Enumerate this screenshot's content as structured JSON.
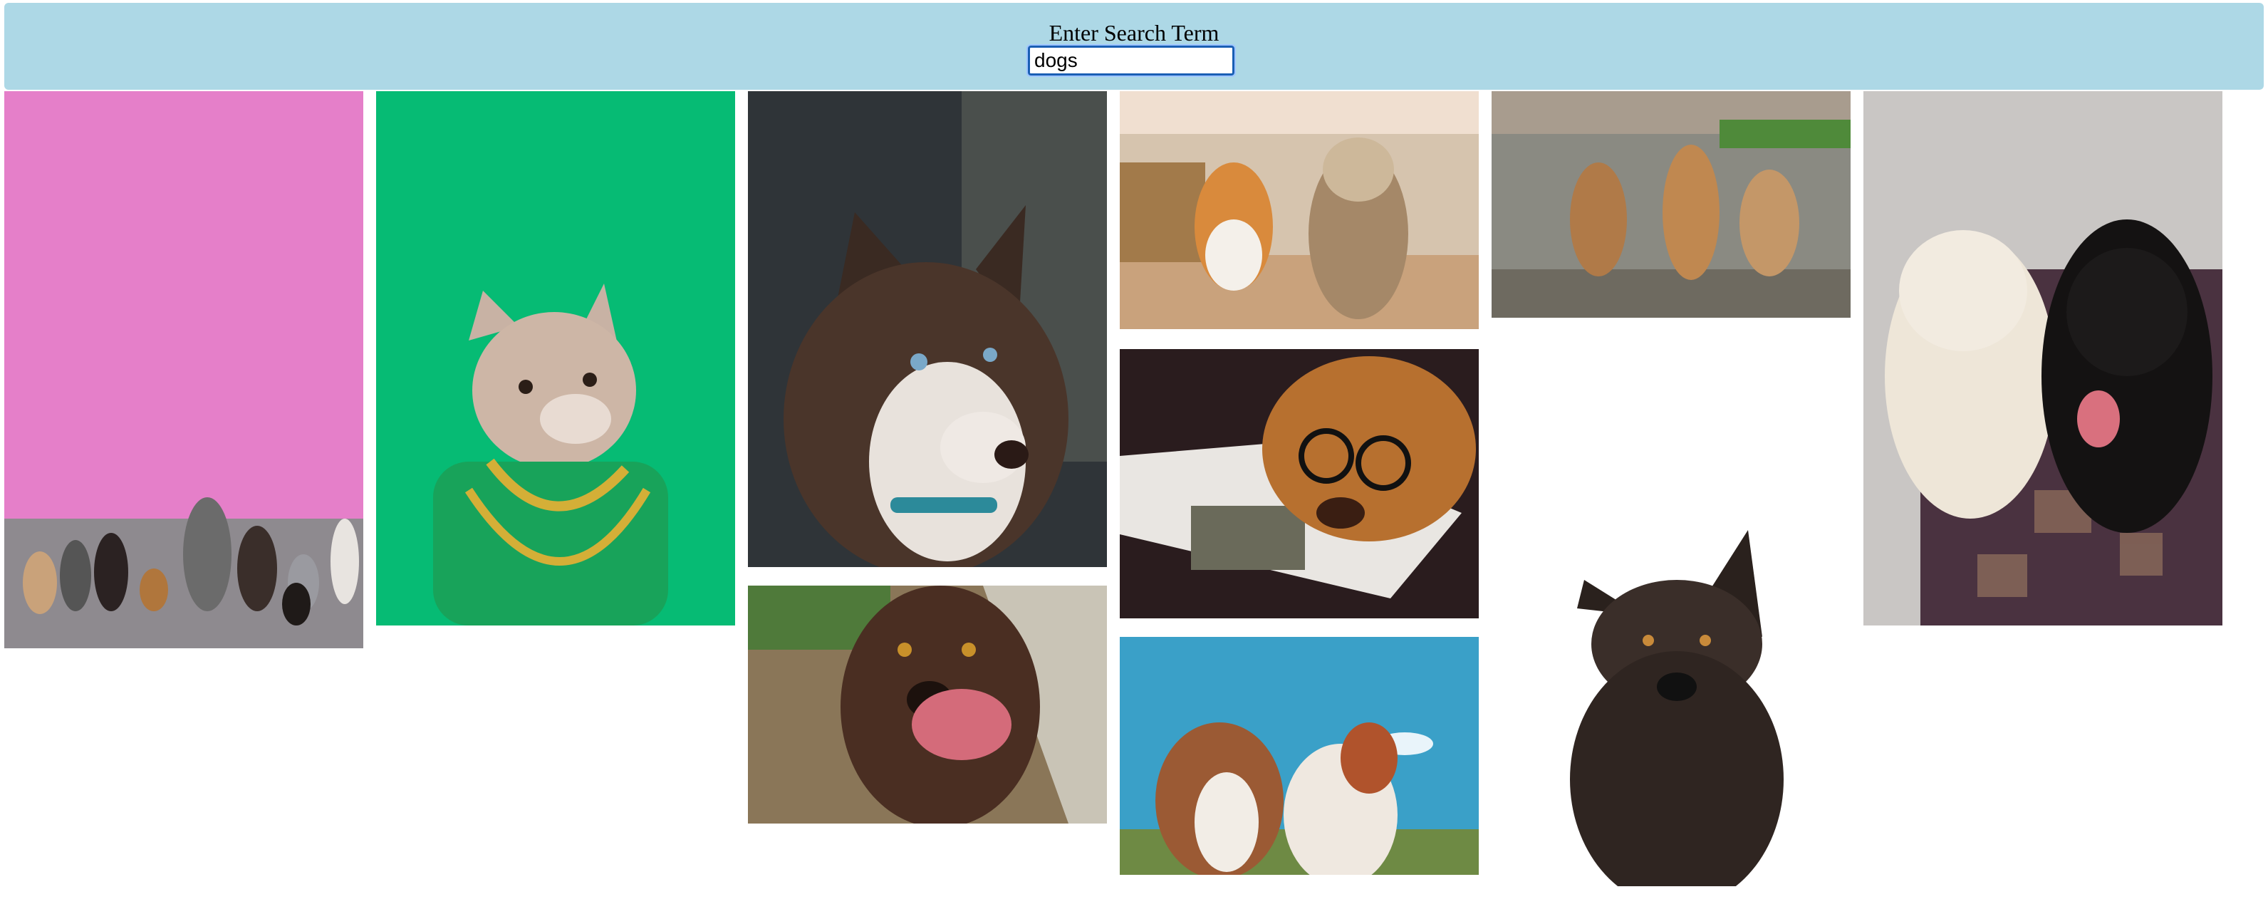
{
  "search": {
    "label": "Enter Search Term",
    "value": "dogs"
  },
  "colors": {
    "header_bg": "#add8e6",
    "input_border": "#1a5fb4"
  },
  "gallery": {
    "items": [
      {
        "name": "dogs-pink-wall-photo",
        "icon": "photo"
      },
      {
        "name": "french-bulldog-green-photo",
        "icon": "photo"
      },
      {
        "name": "husky-portrait-photo",
        "icon": "photo"
      },
      {
        "name": "chocolate-lab-tongue-photo",
        "icon": "photo"
      },
      {
        "name": "corgi-yorkie-running-photo",
        "icon": "photo"
      },
      {
        "name": "dog-glasses-magazine-photo",
        "icon": "photo"
      },
      {
        "name": "dogs-looking-up-sky-photo",
        "icon": "photo"
      },
      {
        "name": "three-puppies-road-photo",
        "icon": "photo"
      },
      {
        "name": "black-dog-white-bg-photo",
        "icon": "photo"
      },
      {
        "name": "doodle-and-black-lab-rug-photo",
        "icon": "photo"
      }
    ]
  }
}
